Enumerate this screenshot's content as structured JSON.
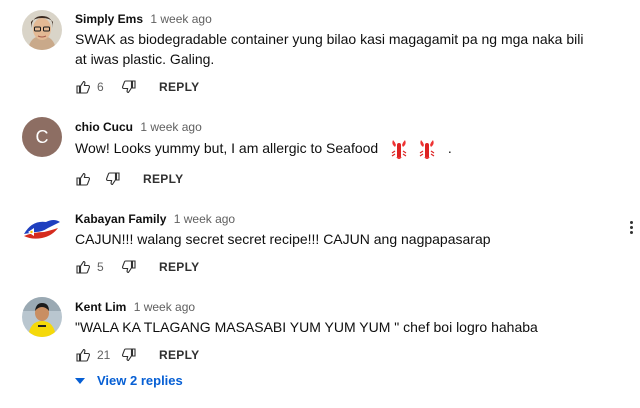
{
  "comments": [
    {
      "author": "Simply Ems",
      "time": "1 week ago",
      "text": "SWAK as biodegradable container yung bilao kasi magagamit pa ng mga naka bili at iwas plastic. Galing.",
      "likes": "6",
      "reply_label": "REPLY",
      "avatar_icon": "photo-avatar-girl-glasses"
    },
    {
      "author": "chio Cucu",
      "time": "1 week ago",
      "text": "Wow! Looks yummy but, I am allergic to Seafood",
      "trailing": ".",
      "emoji": [
        "lobster-emoji",
        "lobster-emoji"
      ],
      "likes": "",
      "reply_label": "REPLY",
      "avatar_letter": "C",
      "avatar_color": "#8d6e63"
    },
    {
      "author": "Kabayan Family",
      "time": "1 week ago",
      "text": "CAJUN!!! walang secret secret recipe!!! CAJUN ang nagpapasarap",
      "likes": "5",
      "reply_label": "REPLY",
      "avatar_icon": "philippine-flag-bird-avatar"
    },
    {
      "author": "Kent Lim",
      "time": "1 week ago",
      "text": "\"WALA KA TLAGANG MASASABI YUM YUM YUM \"  chef boi logro hahaba",
      "likes": "21",
      "reply_label": "REPLY",
      "avatar_icon": "photo-avatar-child-yellow-shirt"
    }
  ],
  "view_replies": "View 2 replies",
  "colors": {
    "link": "#065fd4",
    "muted": "#606060"
  }
}
